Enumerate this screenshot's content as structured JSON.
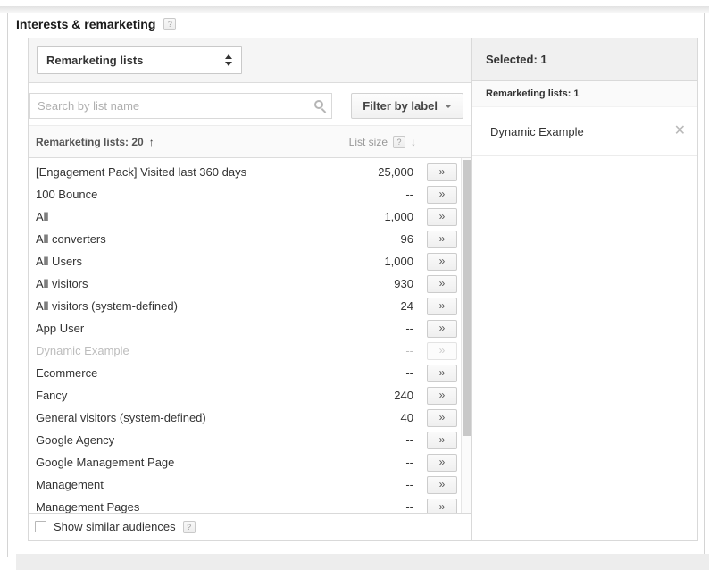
{
  "title": {
    "text": "Interests & remarketing"
  },
  "help_icon": "?",
  "type_selector": {
    "label": "Remarketing lists"
  },
  "search": {
    "placeholder": "Search by list name"
  },
  "filter": {
    "label": "Filter by label"
  },
  "columns": {
    "lists_label": "Remarketing lists: 20",
    "sort_up": "↑",
    "size_label": "List size",
    "sort_down": "↓"
  },
  "row_action": "»",
  "rows": [
    {
      "name": "[Engagement Pack] Visited last 360 days",
      "size": "25,000",
      "disabled": false
    },
    {
      "name": "100 Bounce",
      "size": "--",
      "disabled": false
    },
    {
      "name": "All",
      "size": "1,000",
      "disabled": false
    },
    {
      "name": "All converters",
      "size": "96",
      "disabled": false
    },
    {
      "name": "All Users",
      "size": "1,000",
      "disabled": false
    },
    {
      "name": "All visitors",
      "size": "930",
      "disabled": false
    },
    {
      "name": "All visitors (system-defined)",
      "size": "24",
      "disabled": false
    },
    {
      "name": "App User",
      "size": "--",
      "disabled": false
    },
    {
      "name": "Dynamic Example",
      "size": "--",
      "disabled": true
    },
    {
      "name": "Ecommerce",
      "size": "--",
      "disabled": false
    },
    {
      "name": "Fancy",
      "size": "240",
      "disabled": false
    },
    {
      "name": "General visitors (system-defined)",
      "size": "40",
      "disabled": false
    },
    {
      "name": "Google Agency",
      "size": "--",
      "disabled": false
    },
    {
      "name": "Google Management Page",
      "size": "--",
      "disabled": false
    },
    {
      "name": "Management",
      "size": "--",
      "disabled": false
    },
    {
      "name": "Management Pages",
      "size": "--",
      "disabled": false
    }
  ],
  "footer": {
    "checkbox_label": "Show similar audiences",
    "checkbox_checked": false
  },
  "selected": {
    "header": "Selected: 1",
    "subheader": "Remarketing lists: 1",
    "items": [
      {
        "name": "Dynamic Example"
      }
    ],
    "remove_icon": "✕"
  },
  "colors": {
    "selected_header_bg": "#f0f0f0",
    "panel_border": "#d9d9d9",
    "toolbar_bg": "#f5f5f5",
    "disabled_text": "#bdbdbd",
    "scrollbar_thumb": "#c8c8c8"
  }
}
